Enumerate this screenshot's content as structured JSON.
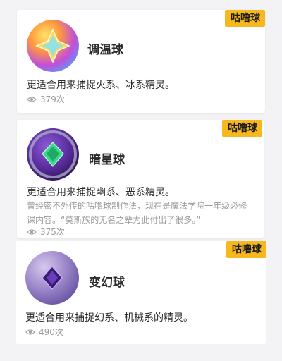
{
  "items": [
    {
      "tag": "咕噜球",
      "title": "调温球",
      "desc": "更适合用来捕捉火系、冰系精灵。",
      "sub": "",
      "views": "379次"
    },
    {
      "tag": "咕噜球",
      "title": "暗星球",
      "desc": "更适合用来捕捉幽系、恶系精灵。",
      "sub": "曾经密不外传的咕噜球制作法，现在是魔法学院一年级必修课内容。“莫斯族的无名之辈为此付出了很多。”",
      "views": "375次"
    },
    {
      "tag": "咕噜球",
      "title": "变幻球",
      "desc": "更适合用来捕捉幻系、机械系的精灵。",
      "sub": "",
      "views": "490次"
    }
  ],
  "icons": {
    "views": "eye-icon"
  },
  "colors": {
    "tag_bg": "#f7b81d"
  }
}
